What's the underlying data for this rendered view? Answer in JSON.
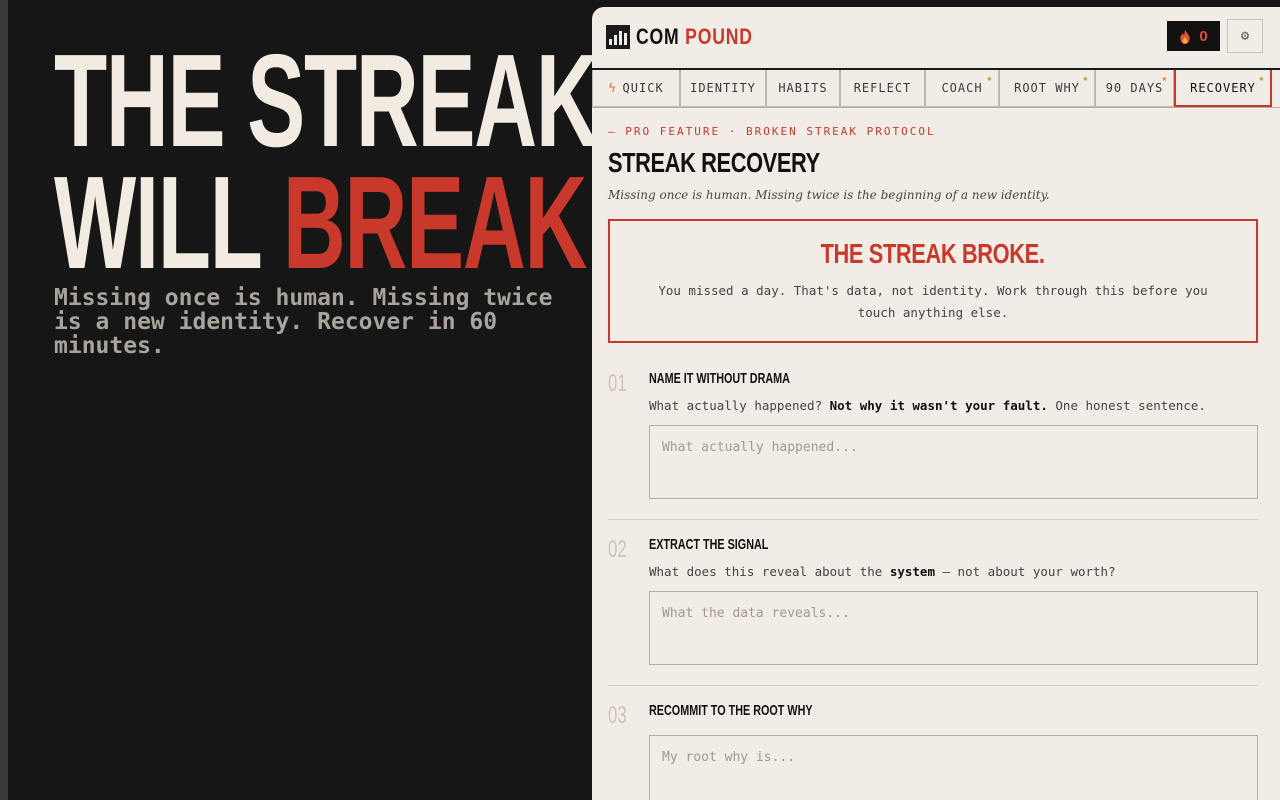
{
  "hero": {
    "line1": "THE STREAK",
    "line2_a": "WILL ",
    "line2_b": "BREAK",
    "subtitle": "Missing once is human. Missing twice is a new identity. Recover in 60 minutes."
  },
  "app": {
    "logo_a": "COM",
    "logo_b": "POUND",
    "streak_count": "0",
    "settings_icon": "gear-icon"
  },
  "tabs": [
    {
      "label": "QUICK",
      "pro": false,
      "active": false
    },
    {
      "label": "IDENTITY",
      "pro": false,
      "active": false
    },
    {
      "label": "HABITS",
      "pro": false,
      "active": false
    },
    {
      "label": "REFLECT",
      "pro": false,
      "active": false
    },
    {
      "label": "COACH",
      "pro": true,
      "active": false
    },
    {
      "label": "ROOT WHY",
      "pro": true,
      "active": false
    },
    {
      "label": "90 DAYS",
      "pro": true,
      "active": false
    },
    {
      "label": "RECOVERY",
      "pro": true,
      "active": true
    }
  ],
  "page": {
    "eyebrow": "— PRO FEATURE · BROKEN STREAK PROTOCOL",
    "title": "STREAK RECOVERY",
    "subtitle": "Missing once is human. Missing twice is the beginning of a new identity."
  },
  "alert": {
    "title": "THE STREAK BROKE.",
    "text": "You missed a day. That's data, not identity. Work through this before you touch anything else."
  },
  "steps": [
    {
      "num": "01",
      "title": "NAME IT WITHOUT DRAMA",
      "desc_a": "What actually happened? ",
      "desc_b": "Not why it wasn't your fault.",
      "desc_c": " One honest sentence.",
      "placeholder": "What actually happened..."
    },
    {
      "num": "02",
      "title": "EXTRACT THE SIGNAL",
      "desc_a": "What does this reveal about the ",
      "desc_b": "system",
      "desc_c": " — not about your worth?",
      "placeholder": "What the data reveals..."
    },
    {
      "num": "03",
      "title": "RECOMMIT TO THE ROOT WHY",
      "placeholder": "My root why is..."
    }
  ],
  "colors": {
    "accent": "#c9392b",
    "background": "#161616",
    "panel": "#f1ece5",
    "pro_star": "#d2862e"
  }
}
